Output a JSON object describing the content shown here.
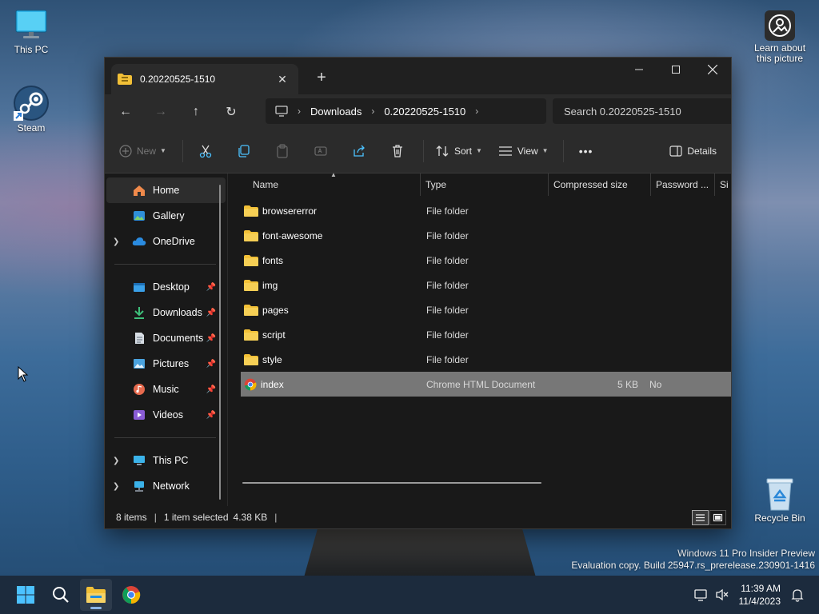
{
  "desktop": {
    "icons": {
      "this_pc": "This PC",
      "steam": "Steam",
      "learn": "Learn about this picture",
      "recycle_bin": "Recycle Bin"
    },
    "watermark": {
      "line1": "Windows 11 Pro Insider Preview",
      "line2": "Evaluation copy. Build 25947.rs_prerelease.230901-1416"
    }
  },
  "explorer": {
    "tab_title": "0.20220525-1510",
    "new_tab_symbol": "+",
    "breadcrumb": [
      "Downloads",
      "0.20220525-1510"
    ],
    "search_placeholder": "Search 0.20220525-1510",
    "toolbar": {
      "new_label": "New",
      "sort_label": "Sort",
      "view_label": "View",
      "more_label": "•••",
      "details_label": "Details"
    },
    "sidebar": {
      "home": "Home",
      "gallery": "Gallery",
      "onedrive": "OneDrive",
      "desktop": "Desktop",
      "downloads": "Downloads",
      "documents": "Documents",
      "pictures": "Pictures",
      "music": "Music",
      "videos": "Videos",
      "this_pc": "This PC",
      "network": "Network"
    },
    "columns": {
      "name": "Name",
      "type": "Type",
      "compressed_size": "Compressed size",
      "password": "Password ...",
      "size": "Si"
    },
    "files": [
      {
        "name": "browsererror",
        "type": "File folder",
        "size": "",
        "password": ""
      },
      {
        "name": "font-awesome",
        "type": "File folder",
        "size": "",
        "password": ""
      },
      {
        "name": "fonts",
        "type": "File folder",
        "size": "",
        "password": ""
      },
      {
        "name": "img",
        "type": "File folder",
        "size": "",
        "password": ""
      },
      {
        "name": "pages",
        "type": "File folder",
        "size": "",
        "password": ""
      },
      {
        "name": "script",
        "type": "File folder",
        "size": "",
        "password": ""
      },
      {
        "name": "style",
        "type": "File folder",
        "size": "",
        "password": ""
      },
      {
        "name": "index",
        "type": "Chrome HTML Document",
        "size": "5 KB",
        "password": "No"
      }
    ],
    "status": {
      "items": "8 items",
      "selected": "1 item selected",
      "selected_size": "4.38 KB"
    }
  },
  "taskbar": {
    "time": "11:39 AM",
    "date": "11/4/2023"
  },
  "colors": {
    "folder": "#f2c037",
    "accent": "#4cc2ff",
    "selected_row": "#777777"
  }
}
